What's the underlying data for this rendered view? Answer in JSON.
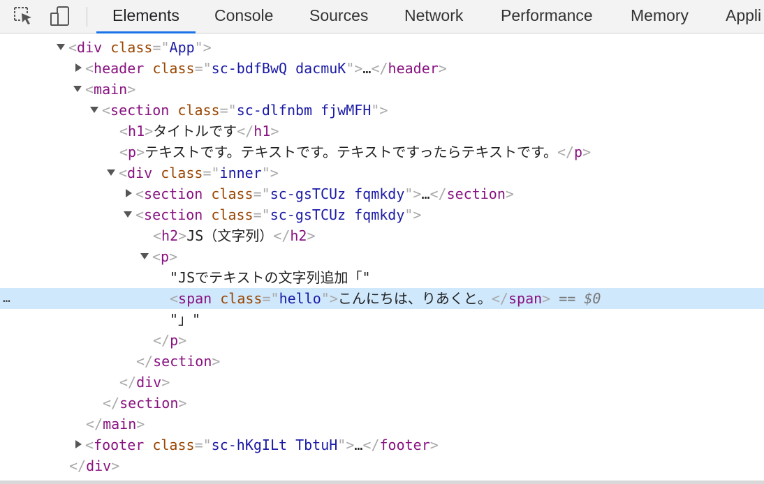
{
  "toolbar": {
    "inspect_icon": "inspect-element-icon",
    "device_icon": "device-toolbar-icon",
    "tabs": [
      "Elements",
      "Console",
      "Sources",
      "Network",
      "Performance",
      "Memory",
      "Appli"
    ],
    "active_tab": "Elements"
  },
  "colors": {
    "tag": "#881280",
    "attr_name": "#994500",
    "attr_value": "#1a1aa6",
    "selected_row_bg": "#cfe8fc",
    "active_tab_underline": "#1a73e8"
  },
  "dom": {
    "div_app": {
      "tag": "div",
      "attr": "class",
      "value": "App"
    },
    "header": {
      "tag": "header",
      "attr": "class",
      "value": "sc-bdfBwQ dacmuK",
      "ellipsis": "…"
    },
    "main": {
      "tag": "main"
    },
    "section_outer": {
      "tag": "section",
      "attr": "class",
      "value": "sc-dlfnbm fjwMFH"
    },
    "h1": {
      "tag": "h1",
      "text": "タイトルです"
    },
    "p_intro": {
      "tag": "p",
      "text": "テキストです。テキストです。テキストですったらテキストです。"
    },
    "div_inner": {
      "tag": "div",
      "attr": "class",
      "value": "inner"
    },
    "section_collapsed": {
      "tag": "section",
      "attr": "class",
      "value": "sc-gsTCUz fqmkdy",
      "ellipsis": "…"
    },
    "section_open": {
      "tag": "section",
      "attr": "class",
      "value": "sc-gsTCUz fqmkdy"
    },
    "h2": {
      "tag": "h2",
      "text": "JS（文字列）"
    },
    "p_js": {
      "tag": "p"
    },
    "text_node_1": "\"JSでテキストの文字列追加「\"",
    "span": {
      "tag": "span",
      "attr": "class",
      "value": "hello",
      "text": "こんにちは、りあくと。"
    },
    "selected_marker": "== $0",
    "gutter_dots": "…",
    "text_node_2": "\"」\"",
    "footer": {
      "tag": "footer",
      "attr": "class",
      "value": "sc-hKgILt TbtuH",
      "ellipsis": "…"
    }
  }
}
